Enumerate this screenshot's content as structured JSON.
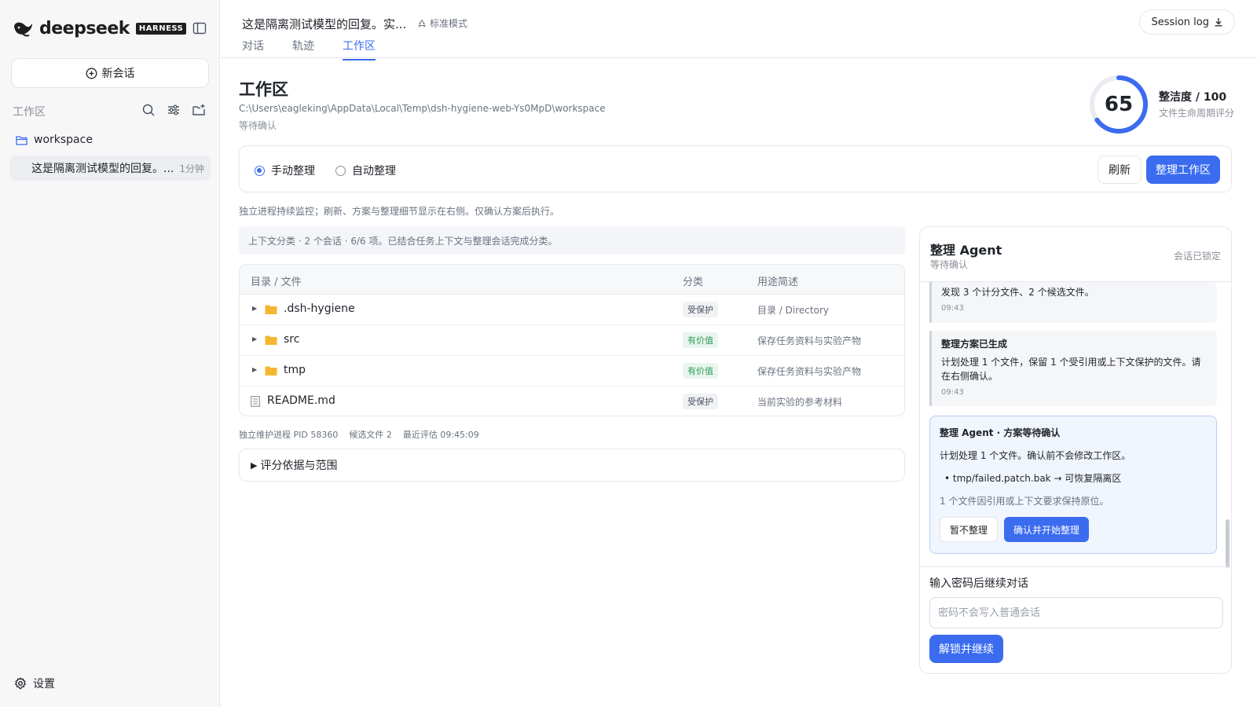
{
  "sidebar": {
    "brand_name": "deepseek",
    "brand_badge": "HARNESS",
    "new_chat_label": "新会话",
    "workspace_label": "工作区",
    "folder_name": "workspace",
    "session_title": "这是隔离测试模型的回复。...",
    "session_time": "1分钟",
    "settings_label": "设置"
  },
  "header": {
    "conversation_title": "这是隔离测试模型的回复。实...",
    "mode_label": "标准模式",
    "tabs": [
      {
        "label": "对话",
        "active": false
      },
      {
        "label": "轨迹",
        "active": false
      },
      {
        "label": "工作区",
        "active": true
      }
    ],
    "session_log_label": "Session log"
  },
  "workspace": {
    "title": "工作区",
    "path": "C:\\Users\\eagleking\\AppData\\Local\\Temp\\dsh-hygiene-web-Ys0MpD\\workspace",
    "status": "等待确认",
    "score": {
      "value": "65",
      "max_label": "整洁度 / 100",
      "subtitle": "文件生命周期评分",
      "fraction": 0.65
    },
    "modes": {
      "manual_label": "手动整理",
      "auto_label": "自动整理",
      "selected": "manual"
    },
    "refresh_label": "刷新",
    "organize_label": "整理工作区",
    "note": "独立进程持续监控；刷新、方案与整理细节显示在右侧。仅确认方案后执行。",
    "context_summary": "上下文分类 · 2 个会话 · 6/6 项。已结合任务上下文与整理会话完成分类。",
    "table": {
      "headers": [
        "目录 / 文件",
        "分类",
        "用途简述"
      ],
      "rows": [
        {
          "name": ".dsh-hygiene",
          "type": "folder",
          "category": "受保护",
          "category_kind": "protected",
          "desc": "目录 / Directory"
        },
        {
          "name": "src",
          "type": "folder",
          "category": "有价值",
          "category_kind": "valuable",
          "desc": "保存任务资料与实验产物"
        },
        {
          "name": "tmp",
          "type": "folder",
          "category": "有价值",
          "category_kind": "valuable",
          "desc": "保存任务资料与实验产物"
        },
        {
          "name": "README.md",
          "type": "file",
          "category": "受保护",
          "category_kind": "protected",
          "desc": "当前实验的参考材料"
        }
      ]
    },
    "meta": {
      "pid": "独立维护进程 PID 58360",
      "candidates": "候选文件 2",
      "last_eval": "最近评估 09:45:09"
    },
    "scope_label": "评分依据与范围"
  },
  "agent": {
    "title": "整理 Agent",
    "subtitle": "等待确认",
    "lock_label": "会话已锁定",
    "messages": [
      {
        "title": "",
        "body": "发现 3 个计分文件、2 个候选文件。",
        "time": "09:43"
      },
      {
        "title": "整理方案已生成",
        "body": "计划处理 1 个文件，保留 1 个受引用或上下文保护的文件。请在右侧确认。",
        "time": "09:43"
      }
    ],
    "confirm": {
      "title": "整理 Agent · 方案等待确认",
      "body": "计划处理 1 个文件。确认前不会修改工作区。",
      "item": "tmp/failed.patch.bak → 可恢复隔离区",
      "note": "1 个文件因引用或上下文要求保持原位。",
      "skip_label": "暂不整理",
      "confirm_label": "确认并开始整理"
    },
    "password": {
      "label": "输入密码后继续对话",
      "placeholder": "密码不会写入普通会话",
      "unlock_label": "解锁并继续"
    }
  },
  "colors": {
    "accent": "#3b6cf0",
    "valuable": "#2e9a5b",
    "folder": "#f5b731"
  }
}
